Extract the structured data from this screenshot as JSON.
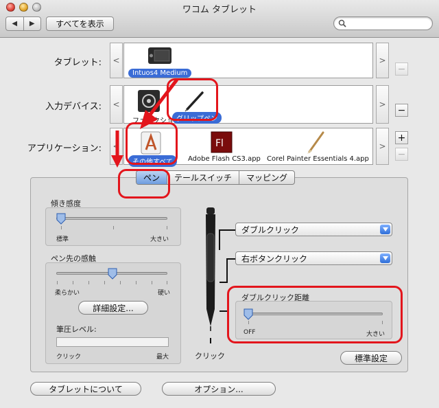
{
  "window": {
    "title": "ワコム タブレット"
  },
  "toolbar": {
    "show_all": "すべてを表示",
    "back": "◀",
    "forward": "▶",
    "search_placeholder": ""
  },
  "tablet_row": {
    "label": "タブレット:",
    "selected": "Intuos4 Medium"
  },
  "input_row": {
    "label": "入力デバイス:",
    "items": [
      "ファンクション",
      "グリップペン"
    ]
  },
  "app_row": {
    "label": "アプリケーション:",
    "items": [
      "その他すべて",
      "Adobe Flash CS3.app",
      "Corel Painter Essentials 4.app"
    ]
  },
  "tabs": [
    "ペン",
    "テールスイッチ",
    "マッピング"
  ],
  "tilt": {
    "label": "傾き感度",
    "min": "標準",
    "max": "大きい",
    "value": 0.0
  },
  "tip": {
    "label": "ペン先の感触",
    "min": "柔らかい",
    "max": "硬い",
    "value": 0.5,
    "details_button": "詳細設定...",
    "pressure_label": "筆圧レベル:",
    "pressure_min": "クリック",
    "pressure_max": "最大"
  },
  "buttons": {
    "upper": "ダブルクリック",
    "lower": "右ボタンクリック"
  },
  "dbl_click_distance": {
    "label": "ダブルクリック距離",
    "min": "OFF",
    "max": "大きい",
    "value": 0.0
  },
  "pen_tip_label": "クリック",
  "default_button": "標準設定",
  "about_button": "タブレットについて",
  "options_button": "オプション...",
  "colors": {
    "accent": "#3a6cd6",
    "annotation": "#e3151c"
  }
}
